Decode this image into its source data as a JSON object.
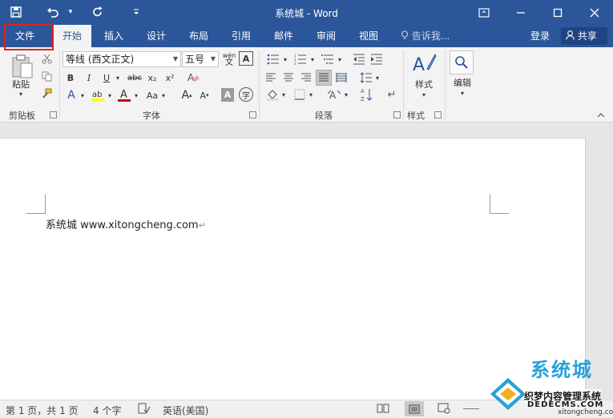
{
  "window": {
    "title": "系统城 - Word"
  },
  "qat": {
    "save_icon": "save-icon",
    "undo_icon": "undo-icon",
    "redo_icon": "redo-icon",
    "customize_icon": "chevron-down-icon"
  },
  "controls": {
    "ribbon_display": "▣",
    "minimize": "—",
    "maximize": "☐",
    "close": "✕"
  },
  "tabs": [
    {
      "label": "文件"
    },
    {
      "label": "开始"
    },
    {
      "label": "插入"
    },
    {
      "label": "设计"
    },
    {
      "label": "布局"
    },
    {
      "label": "引用"
    },
    {
      "label": "邮件"
    },
    {
      "label": "审阅"
    },
    {
      "label": "视图"
    }
  ],
  "tellme": {
    "placeholder": "告诉我..."
  },
  "account": {
    "login": "登录",
    "share": "共享"
  },
  "ribbon": {
    "clipboard": {
      "paste_label": "粘贴",
      "group_label": "剪贴板"
    },
    "font": {
      "font_name": "等线 (西文正文)",
      "font_size": "五号",
      "phonetic_glyph": "wén",
      "group_label": "字体",
      "bold": "B",
      "italic": "I",
      "underline": "U",
      "strike": "abc",
      "subscript": "x₂",
      "superscript": "x²",
      "font_color": "A",
      "change_case": "Aa",
      "grow": "A",
      "shrink": "A",
      "shade": "A",
      "enclose": "字"
    },
    "paragraph": {
      "group_label": "段落"
    },
    "styles": {
      "label": "样式",
      "group_label": "样式"
    },
    "editing": {
      "label": "编辑"
    }
  },
  "document": {
    "text": "系统城 www.xitongcheng.com",
    "para_mark": "↵"
  },
  "status": {
    "page": "第 1 页，共 1 页",
    "words": "4 个字",
    "language": "英语(美国)"
  },
  "watermark": {
    "brand": "系统城",
    "site": "织梦内容管理系统",
    "url": "DEDECMS.COM",
    "url2": "xitongcheng.com"
  },
  "colors": {
    "accent": "#2b579a",
    "highlight": "#e02020",
    "font_color_bar": "#c00000",
    "highlight_bar": "#ffff00"
  }
}
